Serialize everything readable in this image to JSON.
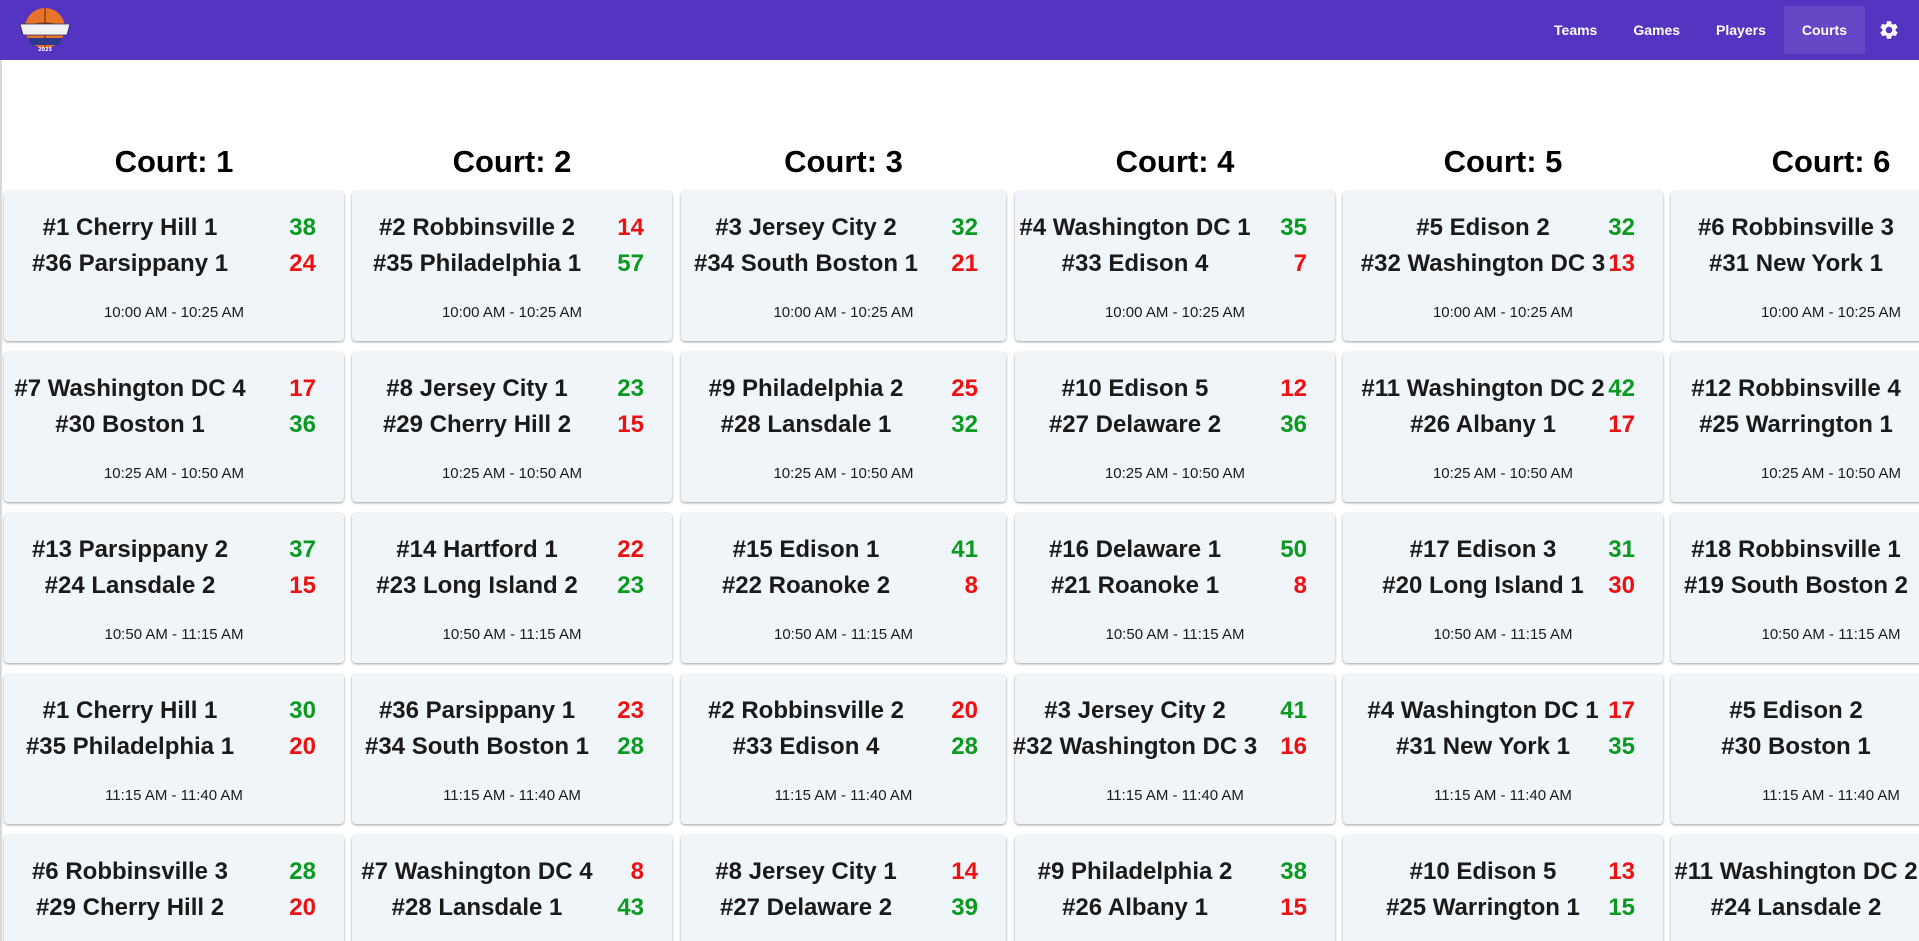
{
  "header": {
    "logo": {
      "line1": "YOGI CUP",
      "year": "2025"
    },
    "nav": [
      "Teams",
      "Games",
      "Players",
      "Courts"
    ],
    "active_nav": "Courts",
    "settings_icon": "gear-icon",
    "colors": {
      "bar": "#5434c0",
      "win": "#0a9a20",
      "lose": "#ee1111",
      "card": "#f0f5f9"
    }
  },
  "courts": [
    {
      "title": "Court: 1",
      "games": [
        {
          "team1": "#1 Cherry Hill 1",
          "score1": "38",
          "team2": "#36 Parsippany 1",
          "score2": "24",
          "time": "10:00 AM - 10:25 AM"
        },
        {
          "team1": "#7 Washington DC 4",
          "score1": "17",
          "team2": "#30 Boston 1",
          "score2": "36",
          "time": "10:25 AM - 10:50 AM"
        },
        {
          "team1": "#13 Parsippany 2",
          "score1": "37",
          "team2": "#24 Lansdale 2",
          "score2": "15",
          "time": "10:50 AM - 11:15 AM"
        },
        {
          "team1": "#1 Cherry Hill 1",
          "score1": "30",
          "team2": "#35 Philadelphia 1",
          "score2": "20",
          "time": "11:15 AM - 11:40 AM"
        },
        {
          "team1": "#6 Robbinsville 3",
          "score1": "28",
          "team2": "#29 Cherry Hill 2",
          "score2": "20",
          "time": ""
        }
      ]
    },
    {
      "title": "Court: 2",
      "games": [
        {
          "team1": "#2 Robbinsville 2",
          "score1": "14",
          "team2": "#35 Philadelphia 1",
          "score2": "57",
          "time": "10:00 AM - 10:25 AM"
        },
        {
          "team1": "#8 Jersey City 1",
          "score1": "23",
          "team2": "#29 Cherry Hill 2",
          "score2": "15",
          "time": "10:25 AM - 10:50 AM"
        },
        {
          "team1": "#14 Hartford 1",
          "score1": "22",
          "team2": "#23 Long Island 2",
          "score2": "23",
          "time": "10:50 AM - 11:15 AM"
        },
        {
          "team1": "#36 Parsippany 1",
          "score1": "23",
          "team2": "#34 South Boston 1",
          "score2": "28",
          "time": "11:15 AM - 11:40 AM"
        },
        {
          "team1": "#7 Washington DC 4",
          "score1": "8",
          "team2": "#28 Lansdale 1",
          "score2": "43",
          "time": ""
        }
      ]
    },
    {
      "title": "Court: 3",
      "games": [
        {
          "team1": "#3 Jersey City 2",
          "score1": "32",
          "team2": "#34 South Boston 1",
          "score2": "21",
          "time": "10:00 AM - 10:25 AM"
        },
        {
          "team1": "#9 Philadelphia 2",
          "score1": "25",
          "team2": "#28 Lansdale 1",
          "score2": "32",
          "time": "10:25 AM - 10:50 AM"
        },
        {
          "team1": "#15 Edison 1",
          "score1": "41",
          "team2": "#22 Roanoke 2",
          "score2": "8",
          "time": "10:50 AM - 11:15 AM"
        },
        {
          "team1": "#2 Robbinsville 2",
          "score1": "20",
          "team2": "#33 Edison 4",
          "score2": "28",
          "time": "11:15 AM - 11:40 AM"
        },
        {
          "team1": "#8 Jersey City 1",
          "score1": "14",
          "team2": "#27 Delaware 2",
          "score2": "39",
          "time": ""
        }
      ]
    },
    {
      "title": "Court: 4",
      "games": [
        {
          "team1": "#4 Washington DC 1",
          "score1": "35",
          "team2": "#33 Edison 4",
          "score2": "7",
          "time": "10:00 AM - 10:25 AM"
        },
        {
          "team1": "#10 Edison 5",
          "score1": "12",
          "team2": "#27 Delaware 2",
          "score2": "36",
          "time": "10:25 AM - 10:50 AM"
        },
        {
          "team1": "#16 Delaware 1",
          "score1": "50",
          "team2": "#21 Roanoke 1",
          "score2": "8",
          "time": "10:50 AM - 11:15 AM"
        },
        {
          "team1": "#3 Jersey City 2",
          "score1": "41",
          "team2": "#32 Washington DC 3",
          "score2": "16",
          "time": "11:15 AM - 11:40 AM"
        },
        {
          "team1": "#9 Philadelphia 2",
          "score1": "38",
          "team2": "#26 Albany 1",
          "score2": "15",
          "time": ""
        }
      ]
    },
    {
      "title": "Court: 5",
      "games": [
        {
          "team1": "#5 Edison 2",
          "score1": "32",
          "team2": "#32 Washington DC 3",
          "score2": "13",
          "time": "10:00 AM - 10:25 AM"
        },
        {
          "team1": "#11 Washington DC 2",
          "score1": "42",
          "team2": "#26 Albany 1",
          "score2": "17",
          "time": "10:25 AM - 10:50 AM"
        },
        {
          "team1": "#17 Edison 3",
          "score1": "31",
          "team2": "#20 Long Island 1",
          "score2": "30",
          "time": "10:50 AM - 11:15 AM"
        },
        {
          "team1": "#4 Washington DC 1",
          "score1": "17",
          "team2": "#31 New York 1",
          "score2": "35",
          "time": "11:15 AM - 11:40 AM"
        },
        {
          "team1": "#10 Edison 5",
          "score1": "13",
          "team2": "#25 Warrington 1",
          "score2": "15",
          "time": ""
        }
      ]
    },
    {
      "title": "Court: 6",
      "games": [
        {
          "team1": "#6 Robbinsville 3",
          "score1": "",
          "team2": "#31 New York 1",
          "score2": "",
          "time": "10:00 AM - 10:25 AM"
        },
        {
          "team1": "#12 Robbinsville 4",
          "score1": "",
          "team2": "#25 Warrington 1",
          "score2": "",
          "time": "10:25 AM - 10:50 AM"
        },
        {
          "team1": "#18 Robbinsville 1",
          "score1": "",
          "team2": "#19 South Boston 2",
          "score2": "",
          "time": "10:50 AM - 11:15 AM"
        },
        {
          "team1": "#5 Edison 2",
          "score1": "",
          "team2": "#30 Boston 1",
          "score2": "",
          "time": "11:15 AM - 11:40 AM"
        },
        {
          "team1": "#11 Washington DC 2",
          "score1": "",
          "team2": "#24 Lansdale 2",
          "score2": "",
          "time": ""
        }
      ]
    }
  ]
}
